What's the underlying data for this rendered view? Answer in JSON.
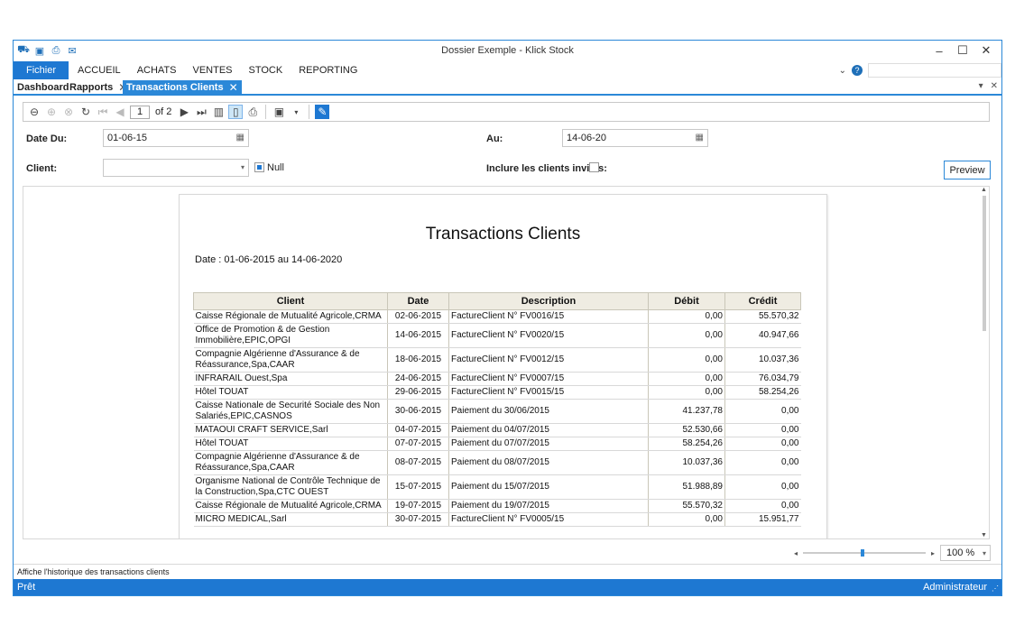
{
  "window": {
    "title": "Dossier Exemple - Klick Stock"
  },
  "qat": {
    "icons": [
      "basket-icon",
      "save-icon",
      "print-icon",
      "mail-icon"
    ]
  },
  "ribbon": {
    "fichier": "Fichier",
    "tabs": [
      "ACCUEIL",
      "ACHATS",
      "VENTES",
      "STOCK",
      "REPORTING"
    ]
  },
  "doctabs": [
    {
      "label": "Dashboard"
    },
    {
      "label": "Rapports"
    },
    {
      "label": "Transactions Clients"
    }
  ],
  "toolbar": {
    "page_current": "1",
    "page_total": "of 2"
  },
  "filters": {
    "date_du_label": "Date Du:",
    "date_du_value": "01-06-15",
    "au_label": "Au:",
    "au_value": "14-06-20",
    "client_label": "Client:",
    "client_value": "",
    "null_label": "Null",
    "null_checked": true,
    "invites_label": "Inclure les clients invités:",
    "invites_checked": false,
    "preview_label": "Preview"
  },
  "report": {
    "title": "Transactions Clients",
    "date_range": "Date : 01-06-2015 au 14-06-2020",
    "columns": [
      "Client",
      "Date",
      "Description",
      "Débit",
      "Crédit"
    ],
    "rows": [
      {
        "client": "Caisse Régionale de Mutualité Agricole,CRMA",
        "date": "02-06-2015",
        "desc": "FactureClient N° FV0016/15",
        "debit": "0,00",
        "credit": "55.570,32"
      },
      {
        "client": "Office de Promotion & de Gestion Immobilière,EPIC,OPGI",
        "date": "14-06-2015",
        "desc": "FactureClient N° FV0020/15",
        "debit": "0,00",
        "credit": "40.947,66"
      },
      {
        "client": "Compagnie Algérienne d'Assurance & de Réassurance,Spa,CAAR",
        "date": "18-06-2015",
        "desc": "FactureClient N° FV0012/15",
        "debit": "0,00",
        "credit": "10.037,36"
      },
      {
        "client": "INFRARAIL Ouest,Spa",
        "date": "24-06-2015",
        "desc": "FactureClient N° FV0007/15",
        "debit": "0,00",
        "credit": "76.034,79"
      },
      {
        "client": "Hôtel TOUAT",
        "date": "29-06-2015",
        "desc": "FactureClient N° FV0015/15",
        "debit": "0,00",
        "credit": "58.254,26"
      },
      {
        "client": "Caisse Nationale de Securité Sociale des Non Salariés,EPIC,CASNOS",
        "date": "30-06-2015",
        "desc": "Paiement du 30/06/2015",
        "debit": "41.237,78",
        "credit": "0,00"
      },
      {
        "client": "MATAOUI CRAFT SERVICE,Sarl",
        "date": "04-07-2015",
        "desc": "Paiement du 04/07/2015",
        "debit": "52.530,66",
        "credit": "0,00"
      },
      {
        "client": "Hôtel TOUAT",
        "date": "07-07-2015",
        "desc": "Paiement du 07/07/2015",
        "debit": "58.254,26",
        "credit": "0,00"
      },
      {
        "client": "Compagnie Algérienne d'Assurance & de Réassurance,Spa,CAAR",
        "date": "08-07-2015",
        "desc": "Paiement du 08/07/2015",
        "debit": "10.037,36",
        "credit": "0,00"
      },
      {
        "client": "Organisme National de Contrôle Technique de la Construction,Spa,CTC OUEST",
        "date": "15-07-2015",
        "desc": "Paiement du 15/07/2015",
        "debit": "51.988,89",
        "credit": "0,00"
      },
      {
        "client": "Caisse Régionale de Mutualité Agricole,CRMA",
        "date": "19-07-2015",
        "desc": "Paiement du 19/07/2015",
        "debit": "55.570,32",
        "credit": "0,00"
      },
      {
        "client": "MICRO MEDICAL,Sarl",
        "date": "30-07-2015",
        "desc": "FactureClient N° FV0005/15",
        "debit": "0,00",
        "credit": "15.951,77"
      }
    ]
  },
  "zoom": {
    "value": "100 %",
    "level_percent": 100
  },
  "hint": "Affiche l'historique des transactions clients",
  "status": {
    "left": "Prêt",
    "right": "Administrateur"
  }
}
